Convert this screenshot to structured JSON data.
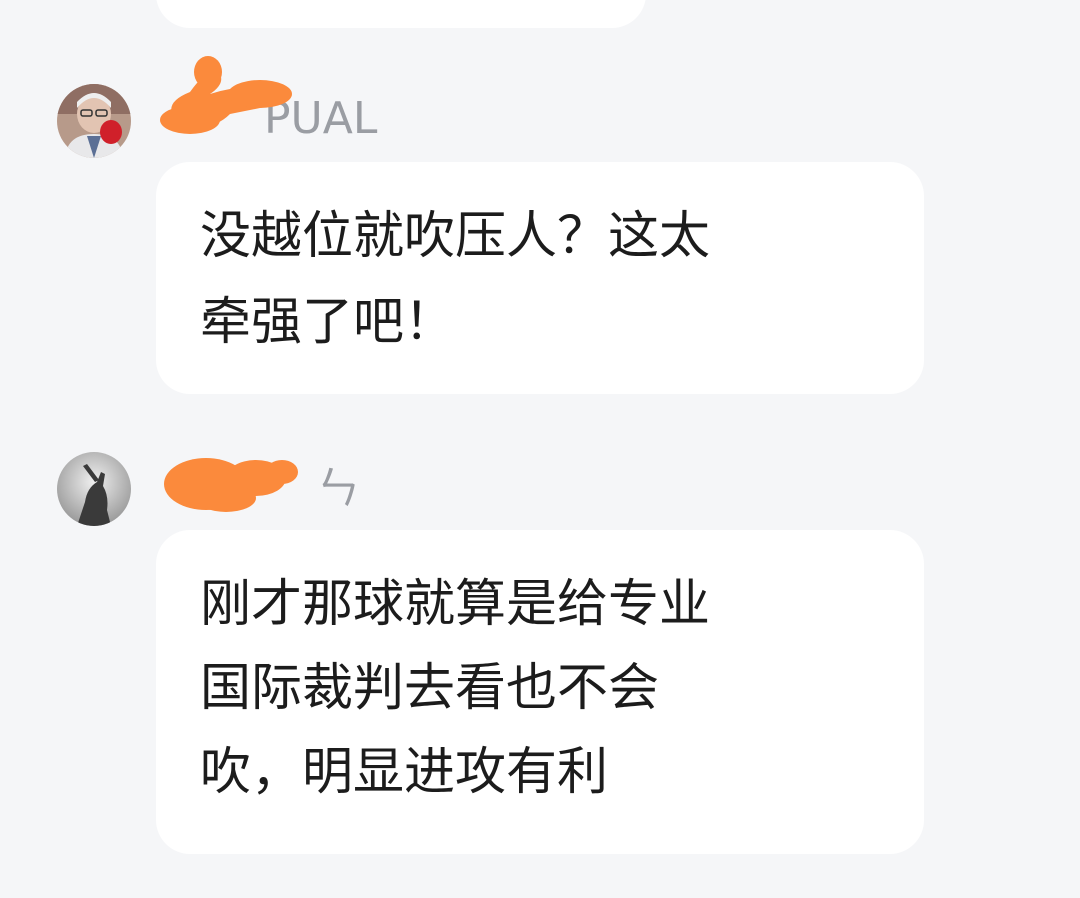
{
  "messages": [
    {
      "username_visible": "PUAL",
      "avatar": "user-photo-elderly-man",
      "text_lines": [
        "没越位就吹压人？这太",
        "牵强了吧！"
      ]
    },
    {
      "username_visible": "ㄣ",
      "avatar": "user-photo-silhouette-monochrome",
      "text_lines": [
        "刚才那球就算是给专业",
        "国际裁判去看也不会",
        "吹，明显进攻有利"
      ]
    }
  ],
  "colors": {
    "background": "#f5f6f8",
    "bubble": "#ffffff",
    "text": "#1c1c1c",
    "username": "#9a9da3",
    "redaction": "#fb8a3c"
  }
}
